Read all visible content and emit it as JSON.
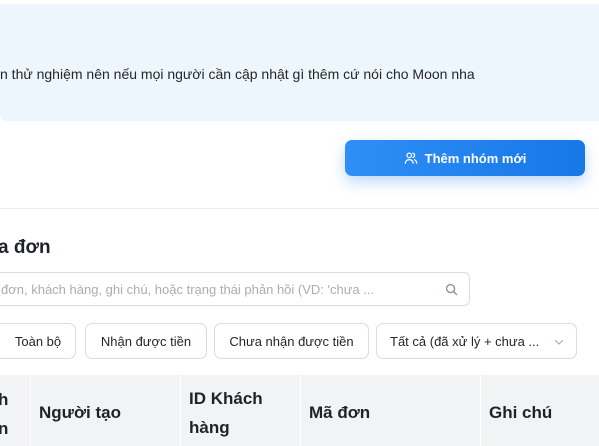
{
  "notice": {
    "text": "n thử nghiệm nên nếu mọi người cần cập nhật gì thêm cứ nói cho Moon nha"
  },
  "actions": {
    "add_group_label": "Thêm nhóm mới",
    "add_group_icon": "users-icon"
  },
  "section": {
    "title": "a đơn"
  },
  "search": {
    "placeholder": "đơn, khách hàng, ghi chú, hoặc trạng thái phản hồi (VD: 'chưa ...",
    "value": "",
    "button_icon": "search-icon"
  },
  "filters": {
    "all_label": "Toàn bộ",
    "received_label": "Nhận được tiền",
    "not_received_label": "Chưa nhận được tiền",
    "status_select_value": "Tất cả (đã xử lý + chưa ..."
  },
  "table": {
    "headers": [
      {
        "line1": "h",
        "line2": "n"
      },
      {
        "line1": "Người tạo",
        "line2": ""
      },
      {
        "line1": "ID Khách",
        "line2": "hàng"
      },
      {
        "line1": "Mã đơn",
        "line2": ""
      },
      {
        "line1": "Ghi chú",
        "line2": ""
      }
    ]
  },
  "colors": {
    "primary": "#1677e6",
    "notice_bg": "#eef6fd",
    "header_bg": "#f2f3f5"
  }
}
